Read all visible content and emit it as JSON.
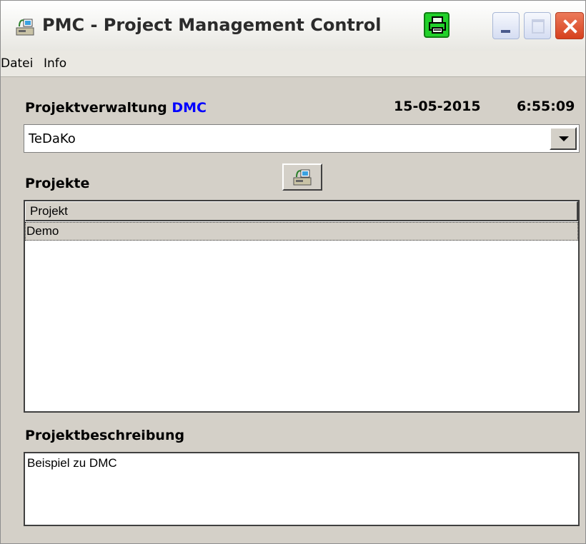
{
  "window": {
    "title": "PMC - Project Management Control",
    "app_icon": "server-computer-icon",
    "print_icon": "printer-icon",
    "controls": [
      "minimize-icon",
      "maximize-icon",
      "close-icon"
    ]
  },
  "menu": {
    "items": [
      "Datei",
      "Info"
    ]
  },
  "header": {
    "label": "Projektverwaltung",
    "accent": "DMC",
    "accent_color": "#0000ff",
    "date": "15-05-2015",
    "time": "6:55:09"
  },
  "combo": {
    "value": "TeDaKo"
  },
  "projects": {
    "label": "Projekte",
    "refresh_icon": "refresh-projects-icon",
    "column": "Projekt",
    "rows": [
      "Demo"
    ]
  },
  "description": {
    "label": "Projektbeschreibung",
    "text": "Beispiel zu DMC"
  }
}
